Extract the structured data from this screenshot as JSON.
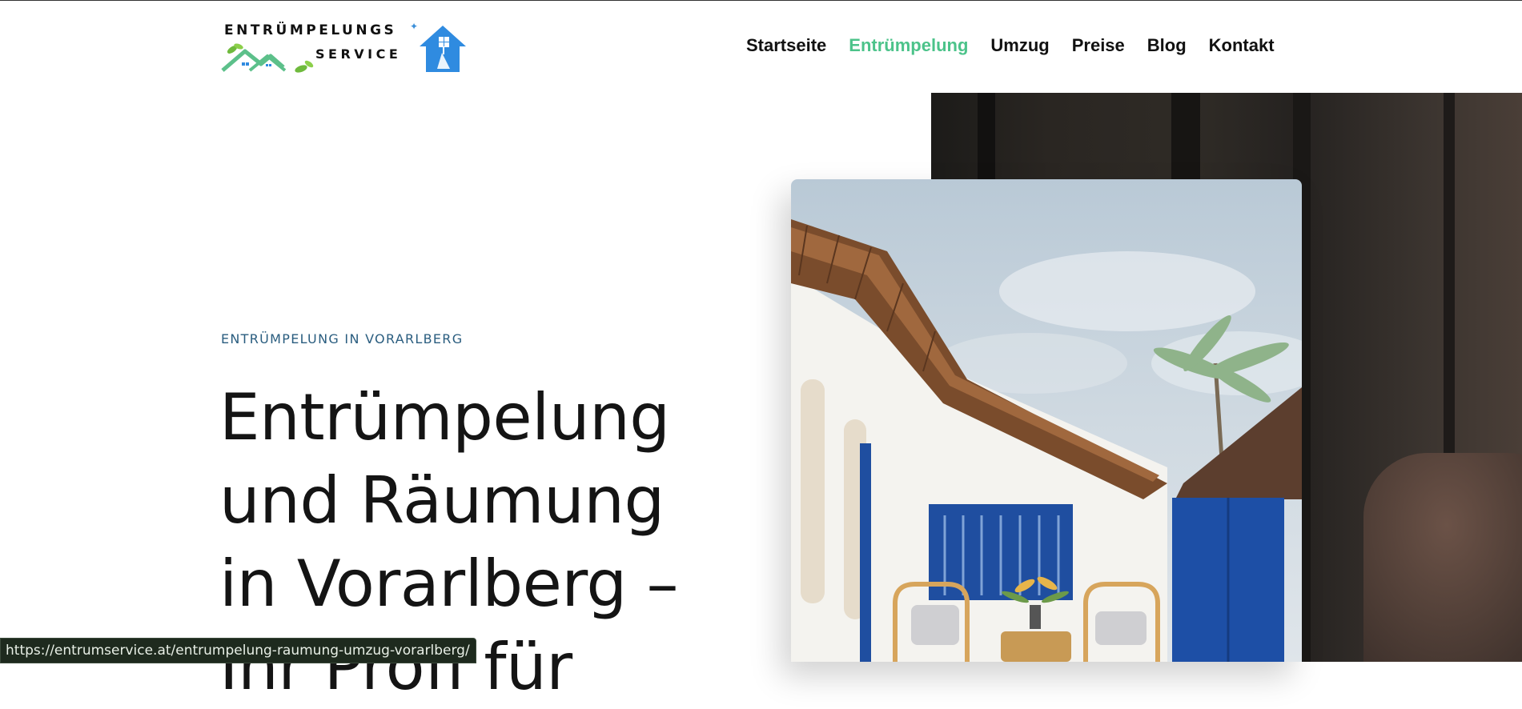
{
  "logo": {
    "line1": "ENTRÜMPELUNGS",
    "line2": "SERVICE",
    "icons": [
      "roofs-icon",
      "house-broom-icon"
    ],
    "colors": {
      "green": "#5cc08a",
      "blue": "#2f8be0"
    }
  },
  "nav": {
    "items": [
      {
        "label": "Startseite",
        "active": false
      },
      {
        "label": "Entrümpelung",
        "active": true
      },
      {
        "label": "Umzug",
        "active": false
      },
      {
        "label": "Preise",
        "active": false
      },
      {
        "label": "Blog",
        "active": false
      },
      {
        "label": "Kontakt",
        "active": false
      }
    ],
    "active_color": "#4cc38a"
  },
  "hero": {
    "eyebrow": "ENTRÜMPELUNG IN VORARLBERG",
    "title": "Entrümpelung und Räumung in Vorarlberg – Ihr Profi für"
  },
  "status": {
    "url": "https://entrumservice.at/entrumpelung-raumung-umzug-vorarlberg/"
  }
}
